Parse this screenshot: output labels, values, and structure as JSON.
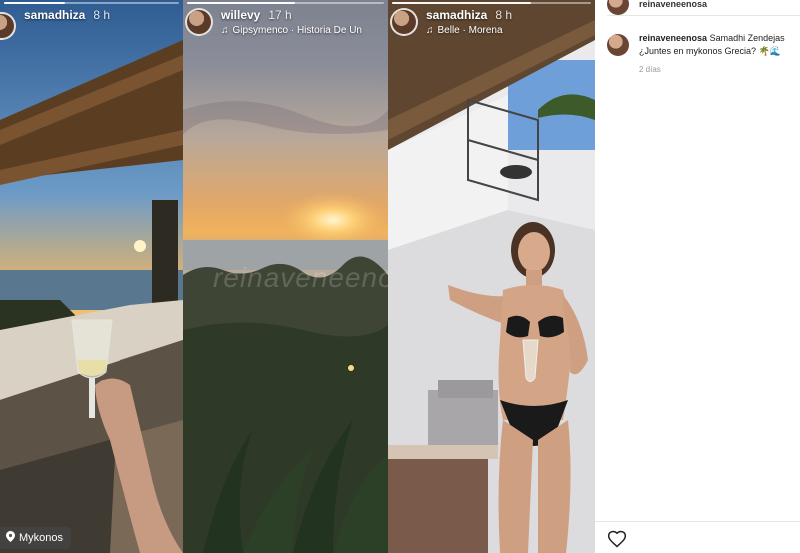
{
  "stories": [
    {
      "username": "samadhiza",
      "time": "8 h",
      "location": "Mykonos",
      "progress": 0.35
    },
    {
      "username": "willevy",
      "time": "17 h",
      "music": "Gipsymenco · Historia De Un",
      "watermark": "reinaveneenosa",
      "progress": 0.55
    },
    {
      "username": "samadhiza",
      "time": "8 h",
      "music": "Belle · Morena",
      "progress": 0.7
    }
  ],
  "sidebar": {
    "top_username": "reinaveneenosa",
    "comment": {
      "username": "reinaveneenosa",
      "text": "Samadhi Zendejas ¿Juntes en mykonos Grecia? 🌴🌊",
      "age": "2 días"
    }
  },
  "icons": {
    "music": "music-note-icon",
    "location": "location-pin-icon",
    "like": "heart-outline-icon"
  }
}
